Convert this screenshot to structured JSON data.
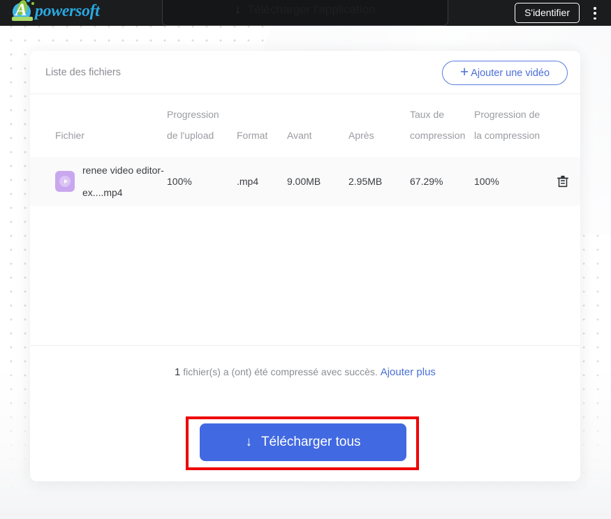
{
  "topbar": {
    "logo_text": "powersoft",
    "logo_initial": "A",
    "download_app_label": "Télécharger l'application",
    "download_app_icon": "arrow-down-icon",
    "signin_label": "S'identifier",
    "menu_icon": "kebab-menu-icon"
  },
  "card": {
    "title": "Liste des fichiers",
    "add_video_label": "Ajouter une vidéo",
    "add_video_icon": "plus-icon",
    "table": {
      "headers": {
        "file": "Fichier",
        "upload_progress_l1": "Progression",
        "upload_progress_l2": "de l'upload",
        "format": "Format",
        "before": "Avant",
        "after": "Après",
        "rate_l1": "Taux de",
        "rate_l2": "compression",
        "progress_l1": "Progression de",
        "progress_l2": "la compression"
      },
      "rows": [
        {
          "icon": "video-file-icon",
          "name_line1": "renee video editor-",
          "name_line2": "ex....mp4",
          "upload_progress": "100%",
          "format": ".mp4",
          "before": "9.00MB",
          "after": "2.95MB",
          "rate": "67.29%",
          "progress": "100%",
          "delete_icon": "trash-icon"
        }
      ]
    },
    "status": {
      "count": "1",
      "message": "fichier(s) a (ont) été compressé avec succès.",
      "link": "Ajouter plus"
    },
    "download_all": {
      "label": "Télécharger tous",
      "icon": "arrow-down-icon",
      "highlighted": true
    }
  },
  "colors": {
    "accent_blue": "#4169e1",
    "link_blue": "#4a6fd8",
    "highlight_red": "#ee0000",
    "file_icon_purple": "#c9a7ef",
    "topbar_dark": "#1b1c1e",
    "logo_blue": "#2aa8e0",
    "logo_green": "#8bc63f"
  }
}
